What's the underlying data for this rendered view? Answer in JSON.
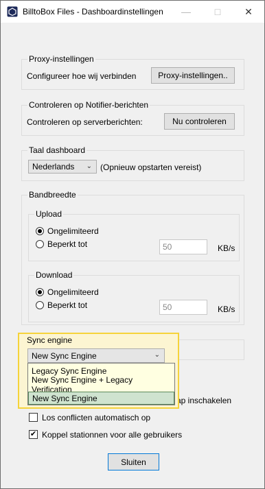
{
  "window": {
    "title": "BilltoBox Files - Dashboardinstellingen"
  },
  "proxy": {
    "title": "Proxy-instellingen",
    "label": "Configureer hoe wij verbinden",
    "button": "Proxy-instellingen.."
  },
  "notifier": {
    "title": "Controleren op Notifier-berichten",
    "label": "Controleren op serverberichten:",
    "button": "Nu controleren"
  },
  "language": {
    "title": "Taal dashboard",
    "selected": "Nederlands",
    "note": "(Opnieuw opstarten vereist)"
  },
  "bandwidth": {
    "title": "Bandbreedte",
    "upload": {
      "title": "Upload",
      "unlimited": "Ongelimiteerd",
      "limited": "Beperkt tot",
      "value": "50",
      "unit": "KB/s",
      "selected": "unlimited"
    },
    "download": {
      "title": "Download",
      "unlimited": "Ongelimiteerd",
      "limited": "Beperkt tot",
      "value": "50",
      "unit": "KB/s",
      "selected": "unlimited"
    }
  },
  "sync": {
    "title": "Sync engine",
    "selected": "New Sync Engine",
    "options": [
      "Legacy Sync Engine",
      "New Sync Engine + Legacy Verification",
      "New Sync Engine"
    ],
    "hidden_fragment_1": "n",
    "hidden_fragment_2": "ap inschakelen"
  },
  "options": {
    "auto_conflicts": {
      "label": "Los conflicten automatisch op",
      "checked": false
    },
    "map_drives": {
      "label": "Koppel stationnen voor alle gebruikers",
      "checked": true
    }
  },
  "close_button": "Sluiten"
}
